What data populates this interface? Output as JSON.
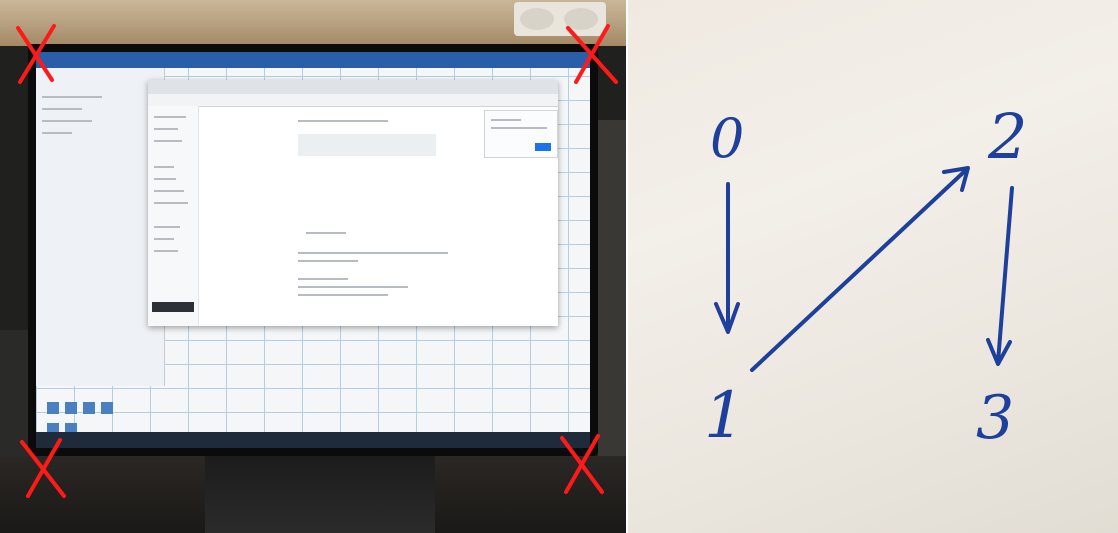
{
  "left_photo": {
    "description_marks": "red-x-corner-marks",
    "mark_color": "#ff1a1a",
    "marks": [
      "top-left",
      "top-right",
      "bottom-left",
      "bottom-right"
    ]
  },
  "right_photo": {
    "ink_color": "#1e3f9a",
    "nodes": [
      {
        "id": "n0",
        "label": "0"
      },
      {
        "id": "n1",
        "label": "1"
      },
      {
        "id": "n2",
        "label": "2"
      },
      {
        "id": "n3",
        "label": "3"
      }
    ],
    "edges": [
      {
        "from": "0",
        "to": "1"
      },
      {
        "from": "1",
        "to": "2"
      },
      {
        "from": "2",
        "to": "3"
      }
    ]
  }
}
